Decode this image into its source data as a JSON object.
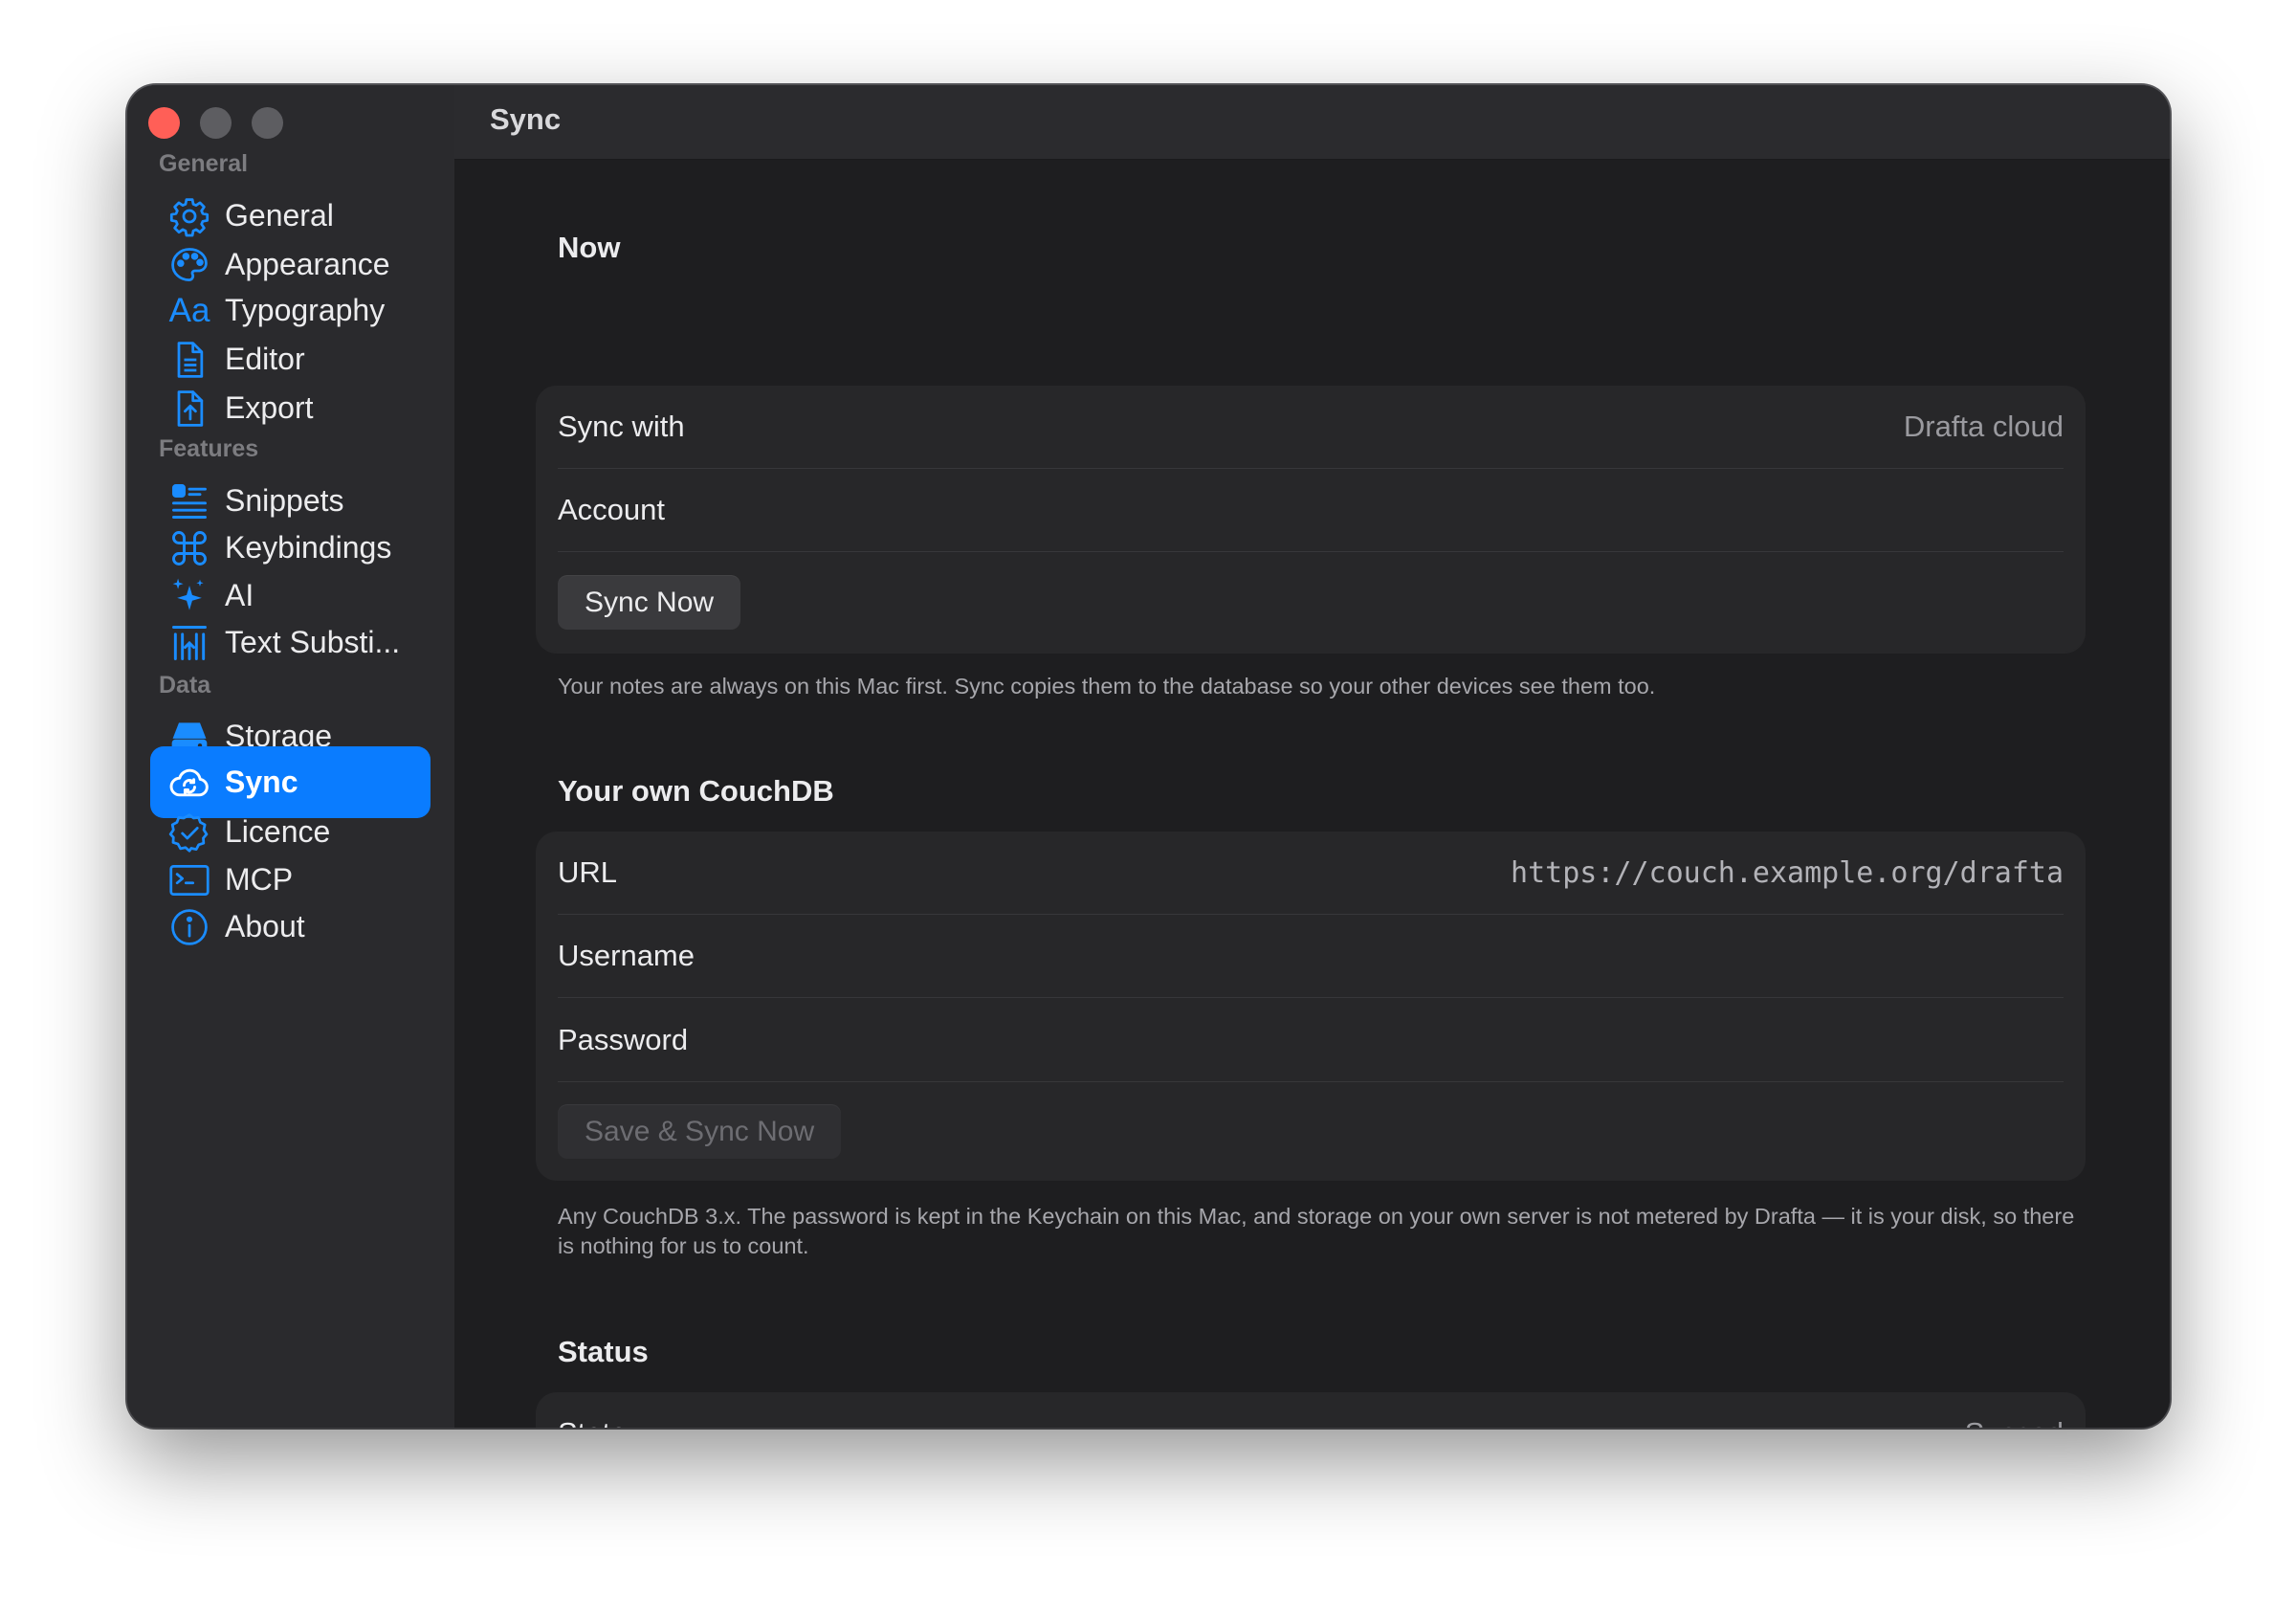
{
  "window": {
    "title": "Sync"
  },
  "sidebar": {
    "sections": [
      {
        "label": "General"
      },
      {
        "label": "Features"
      },
      {
        "label": "Data"
      }
    ],
    "items": [
      {
        "label": "General",
        "icon": "gear-icon"
      },
      {
        "label": "Appearance",
        "icon": "palette-icon"
      },
      {
        "label": "Typography",
        "icon": "typography-icon",
        "glyph": "Aa"
      },
      {
        "label": "Editor",
        "icon": "document-icon"
      },
      {
        "label": "Export",
        "icon": "export-icon"
      },
      {
        "label": "Snippets",
        "icon": "snippets-icon"
      },
      {
        "label": "Keybindings",
        "icon": "command-icon"
      },
      {
        "label": "AI",
        "icon": "sparkles-icon"
      },
      {
        "label": "Text Substi...",
        "icon": "text-substitution-icon"
      },
      {
        "label": "Storage",
        "icon": "storage-drive-icon"
      },
      {
        "label": "Sync",
        "icon": "cloud-sync-icon",
        "selected": true
      },
      {
        "label": "Licence",
        "icon": "badge-check-icon"
      },
      {
        "label": "MCP",
        "icon": "terminal-icon"
      },
      {
        "label": "About",
        "icon": "info-icon"
      }
    ]
  },
  "now": {
    "title": "Now",
    "sync_with_label": "Sync with",
    "sync_with_value": "Drafta cloud",
    "account_label": "Account",
    "sync_now_button": "Sync Now",
    "note": "Your notes are always on this Mac first. Sync copies them to the database so your other devices see them too."
  },
  "couchdb": {
    "title": "Your own CouchDB",
    "url_label": "URL",
    "url_placeholder": "https://couch.example.org/drafta",
    "username_label": "Username",
    "password_label": "Password",
    "save_button": "Save & Sync Now",
    "note": "Any CouchDB 3.x. The password is kept in the Keychain on this Mac, and storage on your own server is not metered by Drafta — it is your disk, so there is nothing for us to count."
  },
  "status": {
    "title": "Status",
    "state_label": "State",
    "state_value": "Synced"
  },
  "colors": {
    "accent": "#0a7cff",
    "close_button": "#ff5f57",
    "window_bg": "#1e1e20",
    "sidebar_bg": "#2a2a2d"
  }
}
